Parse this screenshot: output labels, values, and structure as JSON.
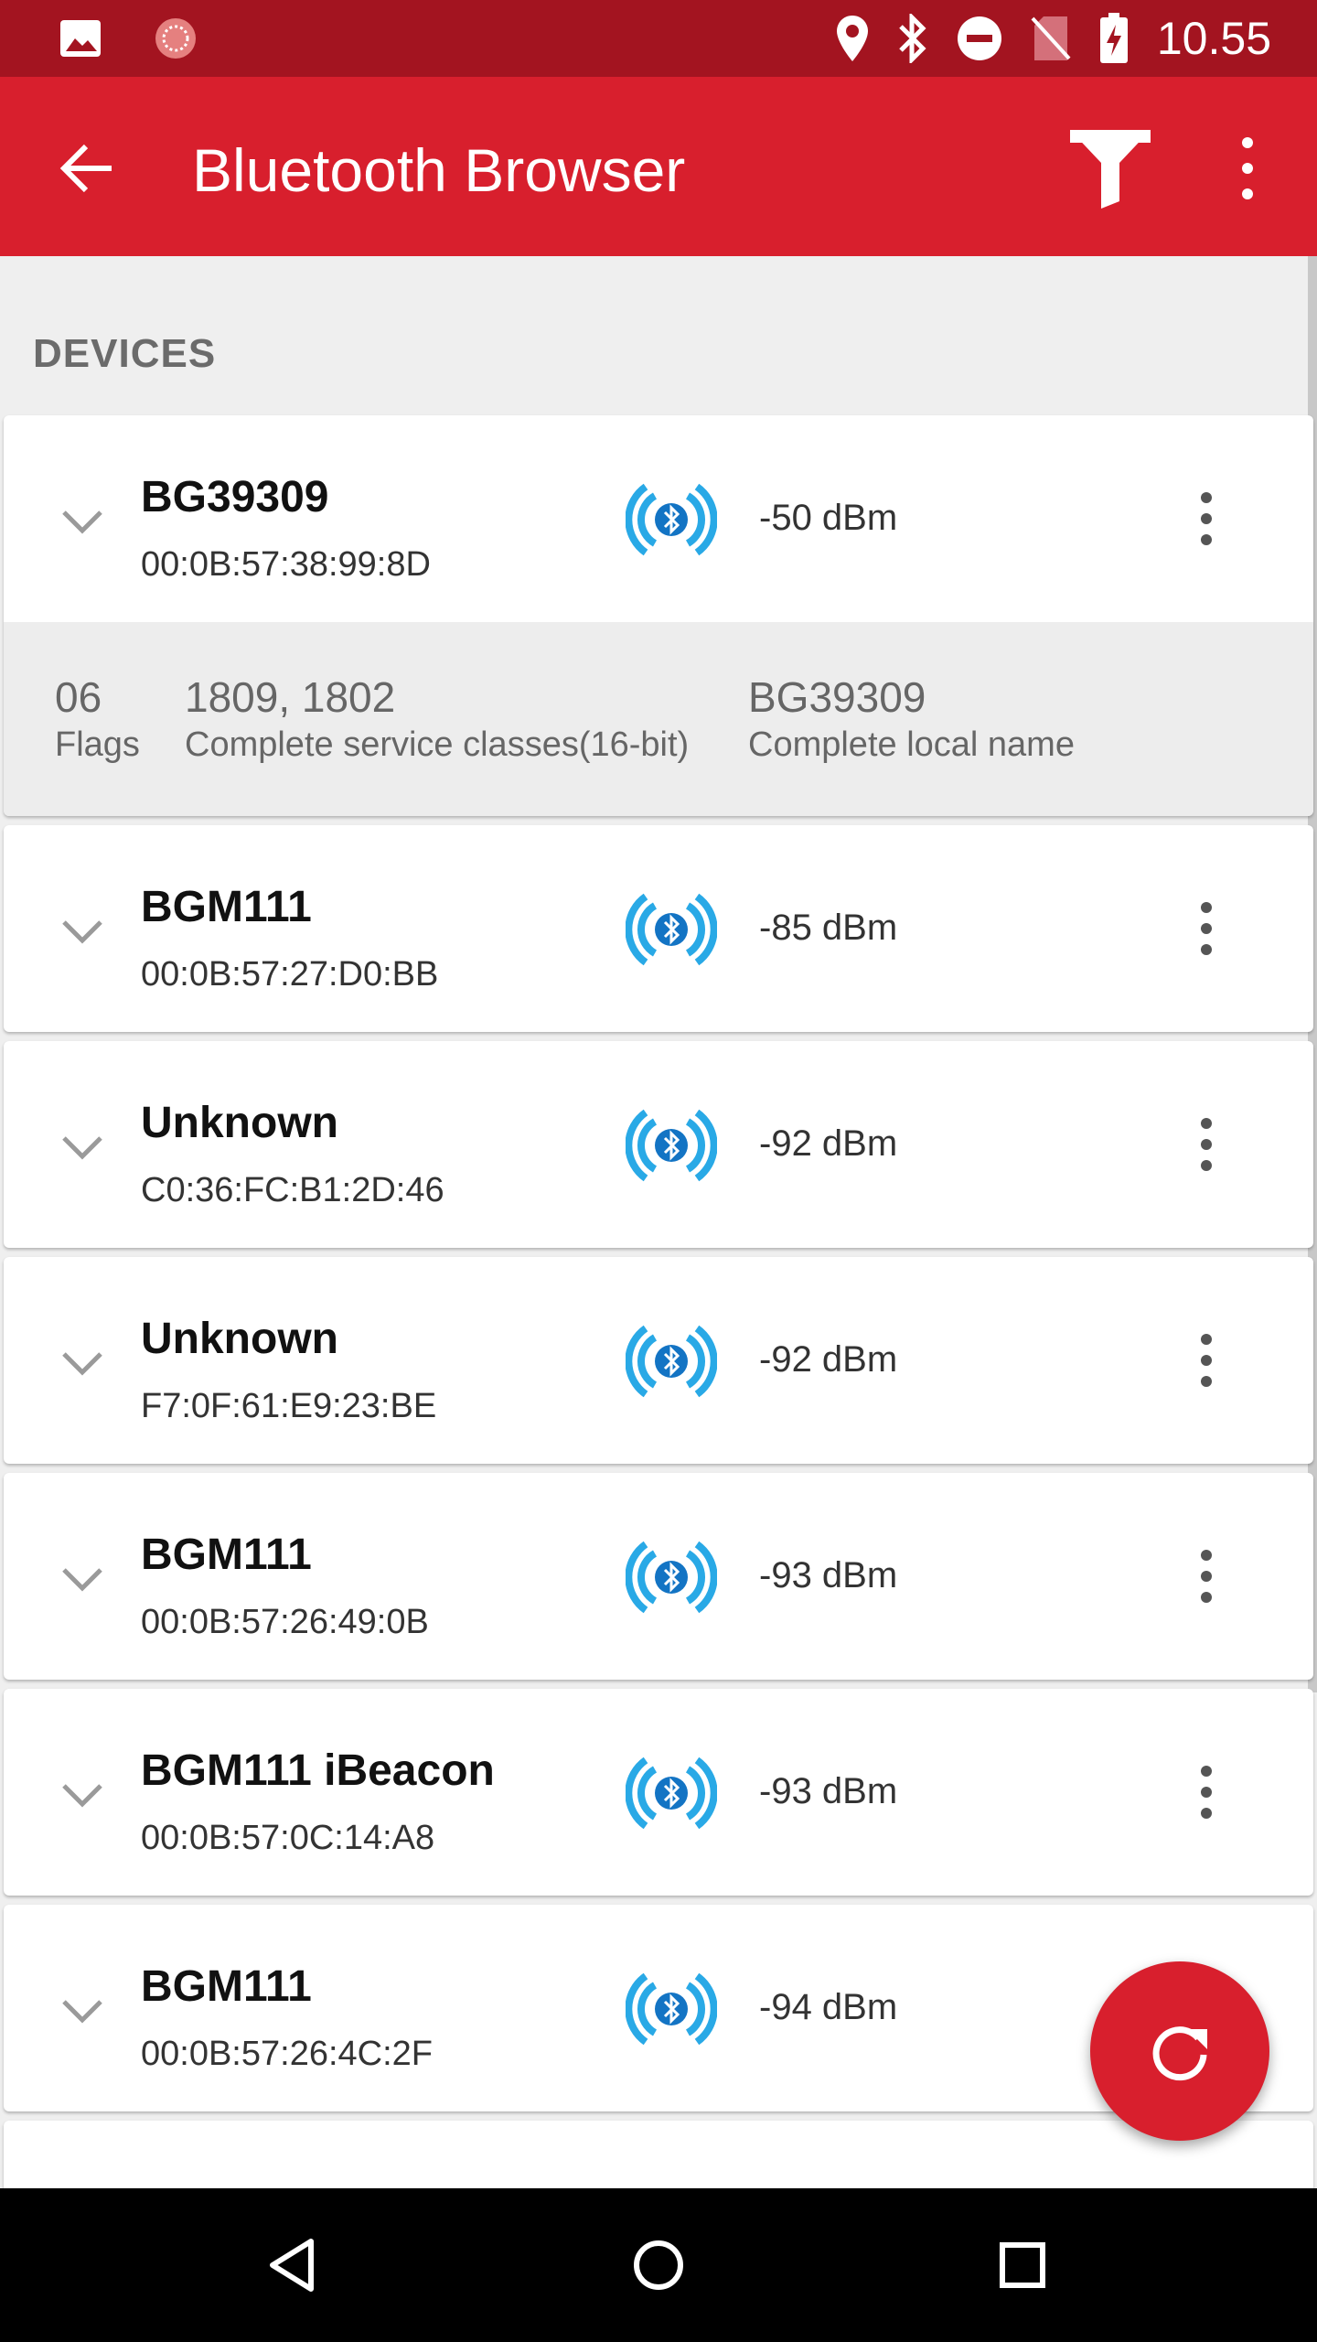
{
  "status_bar": {
    "time": "10.55",
    "icons_left": [
      "gallery-icon",
      "app-loader-icon"
    ],
    "icons_right": [
      "location-icon",
      "bluetooth-icon",
      "do-not-disturb-icon",
      "no-sim-icon",
      "battery-charging-icon"
    ]
  },
  "app_bar": {
    "title": "Bluetooth Browser",
    "color": "#d81f2d",
    "status_color": "#a31420"
  },
  "section": {
    "title": "DEVICES"
  },
  "devices": [
    {
      "name": "BG39309",
      "mac": "00:0B:57:38:99:8D",
      "rssi": "-50 dBm",
      "expanded": true,
      "advertisement": [
        {
          "value": "06",
          "label": "Flags"
        },
        {
          "value": "1809, 1802",
          "label": "Complete service classes(16-bit)"
        },
        {
          "value": "BG39309",
          "label": "Complete local name"
        }
      ]
    },
    {
      "name": "BGM111",
      "mac": "00:0B:57:27:D0:BB",
      "rssi": "-85 dBm"
    },
    {
      "name": "Unknown",
      "mac": "C0:36:FC:B1:2D:46",
      "rssi": "-92 dBm"
    },
    {
      "name": "Unknown",
      "mac": "F7:0F:61:E9:23:BE",
      "rssi": "-92 dBm"
    },
    {
      "name": "BGM111",
      "mac": "00:0B:57:26:49:0B",
      "rssi": "-93 dBm"
    },
    {
      "name": "BGM111 iBeacon",
      "mac": "00:0B:57:0C:14:A8",
      "rssi": "-93 dBm"
    },
    {
      "name": "BGM111",
      "mac": "00:0B:57:26:4C:2F",
      "rssi": "-94 dBm"
    }
  ],
  "fab": {
    "icon": "refresh-icon"
  },
  "nav_bar": {
    "icons": [
      "back-triangle-icon",
      "home-circle-icon",
      "recents-square-icon"
    ]
  }
}
